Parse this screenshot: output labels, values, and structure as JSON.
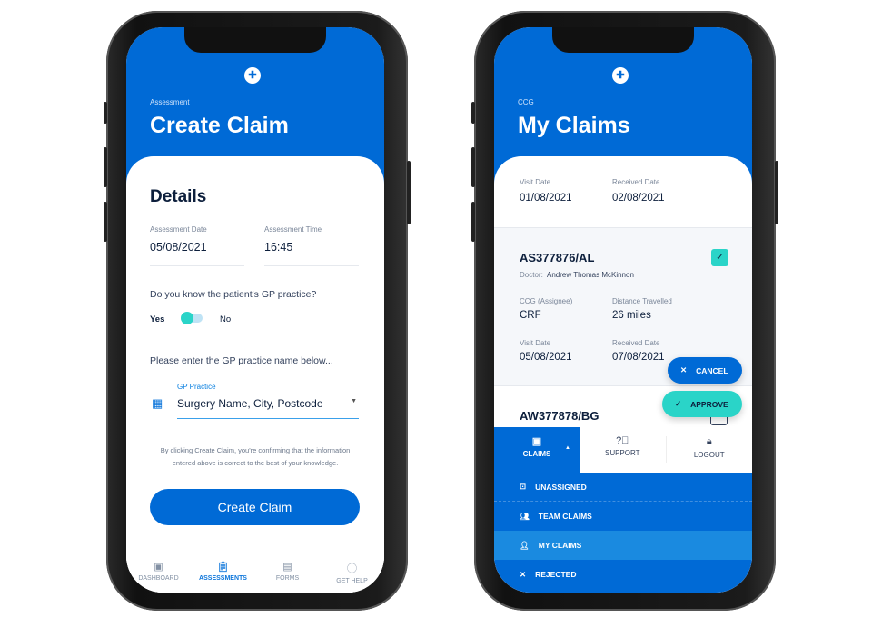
{
  "left": {
    "eyebrow": "Assessment",
    "title": "Create Claim",
    "section": "Details",
    "date_label": "Assessment Date",
    "date_value": "05/08/2021",
    "time_label": "Assessment Time",
    "time_value": "16:45",
    "question": "Do you know the patient's GP practice?",
    "toggle": {
      "yes": "Yes",
      "no": "No",
      "state": "yes"
    },
    "prompt": "Please enter the GP practice name below...",
    "gp_label": "GP Practice",
    "gp_value": "Surgery Name, City, Postcode",
    "disclaimer": "By clicking Create Claim, you're confirming that the information entered above is correct to the best of your knowledge.",
    "submit": "Create Claim",
    "tabs": [
      {
        "label": "DASHBOARD",
        "icon": "dashboard-icon"
      },
      {
        "label": "ASSESSMENTS",
        "icon": "clipboard-icon",
        "active": true
      },
      {
        "label": "FORMS",
        "icon": "document-icon"
      },
      {
        "label": "GET HELP",
        "icon": "help-icon"
      }
    ]
  },
  "right": {
    "eyebrow": "CCG",
    "title": "My Claims",
    "claim0": {
      "visit_label": "Visit Date",
      "visit": "01/08/2021",
      "received_label": "Received Date",
      "received": "02/08/2021"
    },
    "claim1": {
      "id": "AS377876/AL",
      "doctor_label": "Doctor:",
      "doctor": "Andrew Thomas McKinnon",
      "ccg_label": "CCG (Assignee)",
      "ccg": "CRF",
      "distance_label": "Distance Travelled",
      "distance": "26 miles",
      "visit_label": "Visit Date",
      "visit": "05/08/2021",
      "received_label": "Received Date",
      "received": "07/08/2021",
      "checked": true
    },
    "claim2": {
      "id": "AW377878/BG",
      "checked": false
    },
    "cancel": "CANCEL",
    "approve": "APPROVE",
    "nav": {
      "claims": "CLAIMS",
      "support": "SUPPORT",
      "logout": "LOGOUT"
    },
    "menu": [
      {
        "label": "UNASSIGNED",
        "icon": "inbox-icon"
      },
      {
        "label": "TEAM CLAIMS",
        "icon": "team-icon"
      },
      {
        "label": "MY CLAIMS",
        "icon": "user-icon",
        "active": true
      },
      {
        "label": "REJECTED",
        "icon": "x-icon"
      }
    ]
  },
  "colors": {
    "primary": "#006ad6",
    "accent": "#2ad4c8",
    "text": "#0d1f3c"
  }
}
